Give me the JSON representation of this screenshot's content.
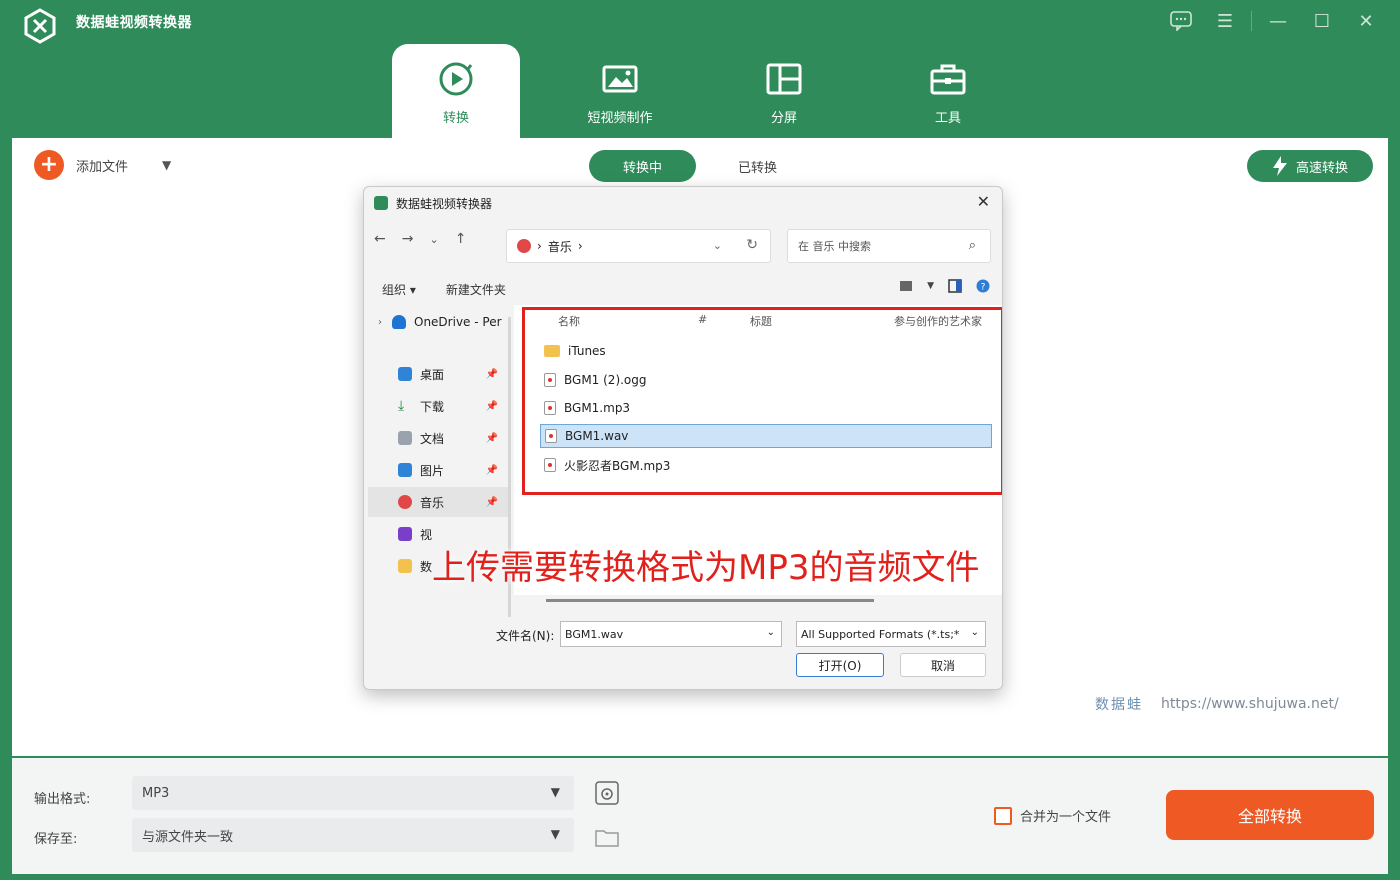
{
  "app": {
    "title": "数据蛙视频转换器",
    "accent": "#2f8c5a",
    "orange": "#ef5a24"
  },
  "window_controls": [
    "chat-icon",
    "menu-icon",
    "minimize-icon",
    "maximize-icon",
    "close-icon"
  ],
  "nav": {
    "tabs": [
      {
        "label": "转换",
        "icon": "convert-icon",
        "active": true
      },
      {
        "label": "短视频制作",
        "icon": "video-maker-icon",
        "active": false
      },
      {
        "label": "分屏",
        "icon": "split-screen-icon",
        "active": false
      },
      {
        "label": "工具",
        "icon": "toolbox-icon",
        "active": false
      }
    ]
  },
  "toolbar": {
    "add_file": "添加文件",
    "status_active": "转换中",
    "status_done": "已转换",
    "fast_convert": "高速转换"
  },
  "dialog": {
    "title": "数据蛙视频转换器",
    "address": "音乐",
    "search_placeholder": "在 音乐 中搜索",
    "organize": "组织 ▾",
    "new_folder": "新建文件夹",
    "sidebar": [
      {
        "label": "OneDrive - Per",
        "pinned": false
      },
      {
        "label": "桌面",
        "pinned": true
      },
      {
        "label": "下载",
        "pinned": true
      },
      {
        "label": "文档",
        "pinned": true
      },
      {
        "label": "图片",
        "pinned": true
      },
      {
        "label": "音乐",
        "pinned": true,
        "selected": true
      },
      {
        "label": "视",
        "pinned": true
      },
      {
        "label": "数",
        "pinned": false
      }
    ],
    "columns": {
      "name": "名称",
      "number": "#",
      "title": "标题",
      "artist": "参与创作的艺术家"
    },
    "files": [
      {
        "name": "iTunes",
        "type": "folder"
      },
      {
        "name": "BGM1 (2).ogg",
        "type": "audio"
      },
      {
        "name": "BGM1.mp3",
        "type": "audio"
      },
      {
        "name": "BGM1.wav",
        "type": "audio",
        "selected": true
      },
      {
        "name": "火影忍者BGM.mp3",
        "type": "audio"
      }
    ],
    "filename_label": "文件名(N):",
    "filename_value": "BGM1.wav",
    "filetype": "All Supported Formats (*.ts;*",
    "open": "打开(O)",
    "cancel": "取消"
  },
  "caption": "上传需要转换格式为MP3的音频文件",
  "watermark": {
    "brand": "数据蛙",
    "url": "https://www.shujuwa.net/"
  },
  "bottom": {
    "format_label": "输出格式:",
    "format_value": "MP3",
    "save_label": "保存至:",
    "save_value": "与源文件夹一致",
    "merge_label": "合并为一个文件",
    "convert_all": "全部转换"
  }
}
